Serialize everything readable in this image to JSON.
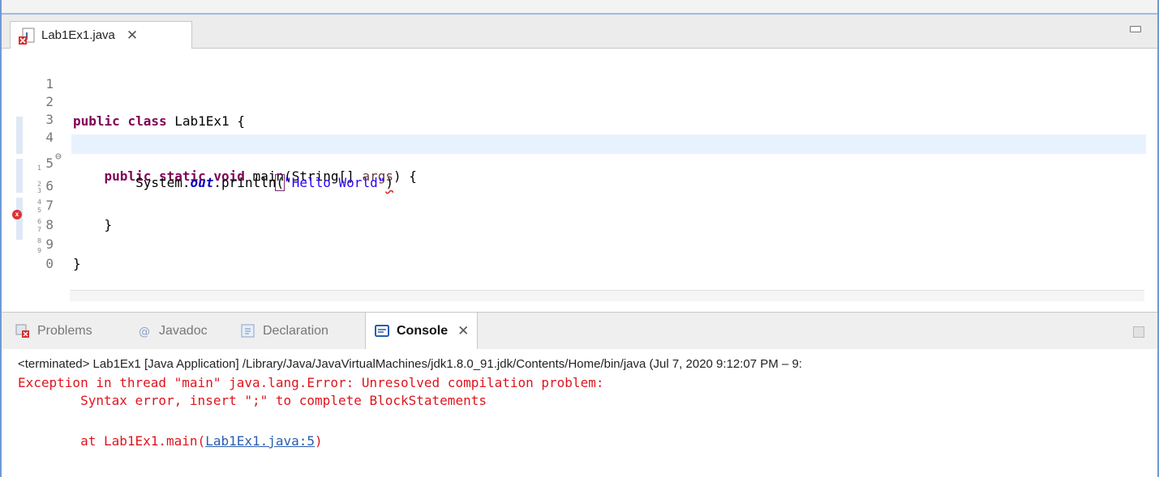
{
  "editor": {
    "tab_label": "Lab1Ex1.java",
    "tab_close_glyph": "✕",
    "lines": [
      {
        "num": "1",
        "text": ""
      },
      {
        "num": "2",
        "text": "public class Lab1Ex1 {"
      },
      {
        "num": "3",
        "text": ""
      },
      {
        "num": "4",
        "text": "    public static void main(String[] args) {"
      },
      {
        "num": "5",
        "text": "        System.out.println(\"Hello World\")"
      },
      {
        "num": "6",
        "text": ""
      },
      {
        "num": "7",
        "text": "    }"
      },
      {
        "num": "8",
        "text": ""
      },
      {
        "num": "9",
        "text": "}"
      },
      {
        "num": "0",
        "text": ""
      }
    ],
    "tokens": {
      "public": "public",
      "class": "class",
      "class_name": "Lab1Ex1",
      "open_brace": "{",
      "static": "static",
      "void": "void",
      "main_sig": "main(String[] ",
      "args": "args",
      "sig_close": ") {",
      "system": "System.",
      "out": "out",
      "println": ".println",
      "open_paren": "(",
      "string": "\"Hello World\"",
      "close_paren": ")",
      "close_brace": "}"
    },
    "tiny_gutter_digits": [
      "1",
      "2",
      "3",
      "4",
      "5",
      "6",
      "7",
      "8",
      "9"
    ],
    "error_marker": "x",
    "fold_marker": "⊖"
  },
  "view_tabs": [
    {
      "label": "Problems",
      "icon": "problems-icon",
      "active": false
    },
    {
      "label": "Javadoc",
      "icon": "at-icon",
      "active": false
    },
    {
      "label": "Declaration",
      "icon": "declaration-icon",
      "active": false
    },
    {
      "label": "Console",
      "icon": "console-icon",
      "active": true
    }
  ],
  "console": {
    "close_glyph": "✕",
    "terminated_line": "<terminated> Lab1Ex1 [Java Application] /Library/Java/JavaVirtualMachines/jdk1.8.0_91.jdk/Contents/Home/bin/java  (Jul 7, 2020 9:12:07 PM – 9:",
    "error_line_1": "Exception in thread \"main\" java.lang.Error: Unresolved compilation problem:",
    "error_line_2": "        Syntax error, insert \";\" to complete BlockStatements",
    "stack_prefix": "        at Lab1Ex1.main(",
    "stack_link": "Lab1Ex1.java:5",
    "stack_suffix": ")"
  },
  "colors": {
    "keyword": "#7f0055",
    "string": "#2a00ff",
    "field": "#0000c0",
    "error_text": "#e0141e",
    "link": "#2a5db0",
    "current_line": "#e8f2fe",
    "frame_border": "#6f9ad6"
  }
}
